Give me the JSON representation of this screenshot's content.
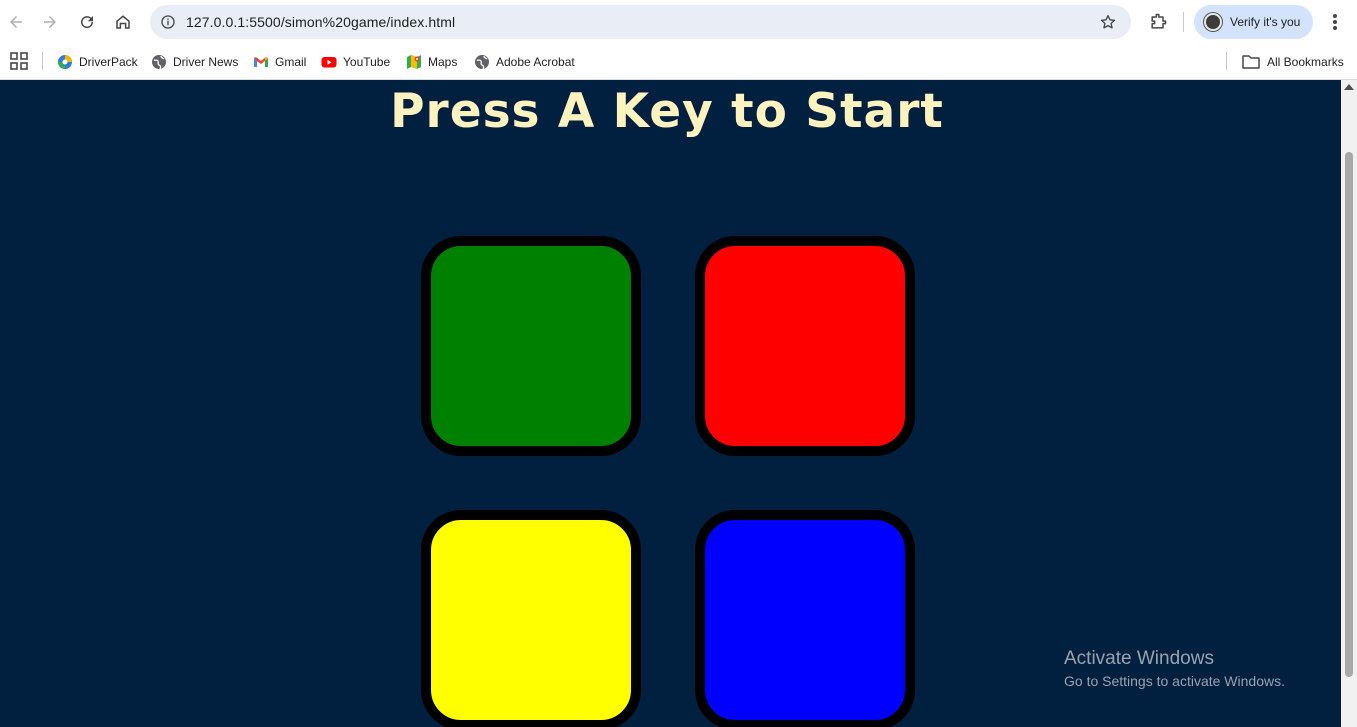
{
  "browser": {
    "url": "127.0.0.1:5500/simon%20game/index.html",
    "profile_label": "Verify it's you",
    "bookmarks": [
      {
        "label": "DriverPack",
        "icon": "driverpack-icon"
      },
      {
        "label": "Driver News",
        "icon": "globe-icon"
      },
      {
        "label": "Gmail",
        "icon": "gmail-icon"
      },
      {
        "label": "YouTube",
        "icon": "youtube-icon"
      },
      {
        "label": "Maps",
        "icon": "maps-icon"
      },
      {
        "label": "Adobe Acrobat",
        "icon": "globe-icon"
      }
    ],
    "all_bookmarks_label": "All Bookmarks"
  },
  "game": {
    "title": "Press A Key to Start",
    "buttons": [
      {
        "id": "green",
        "color": "#008000"
      },
      {
        "id": "red",
        "color": "#FF0000"
      },
      {
        "id": "yellow",
        "color": "#FFFF00"
      },
      {
        "id": "blue",
        "color": "#0000FF"
      }
    ],
    "background_color": "#011F3F",
    "title_color": "#FEF2BF"
  },
  "watermark": {
    "title": "Activate Windows",
    "subtitle": "Go to Settings to activate Windows."
  }
}
